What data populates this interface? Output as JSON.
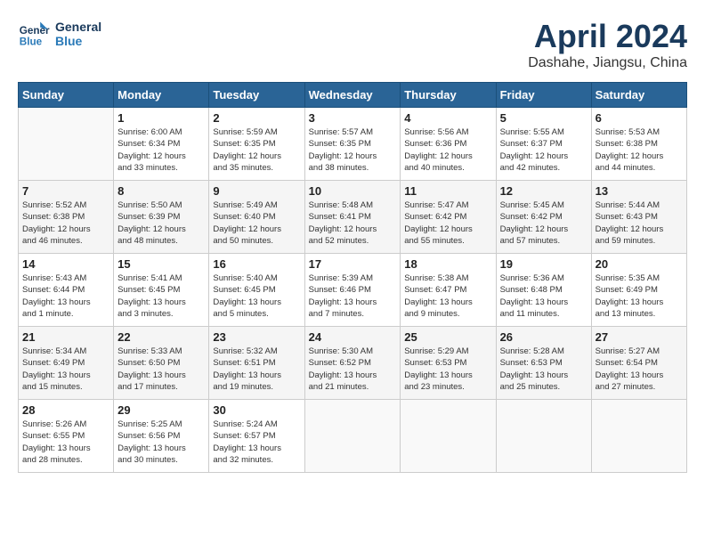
{
  "logo": {
    "line1": "General",
    "line2": "Blue"
  },
  "title": "April 2024",
  "location": "Dashahe, Jiangsu, China",
  "days_of_week": [
    "Sunday",
    "Monday",
    "Tuesday",
    "Wednesday",
    "Thursday",
    "Friday",
    "Saturday"
  ],
  "weeks": [
    [
      {
        "day": "",
        "info": ""
      },
      {
        "day": "1",
        "info": "Sunrise: 6:00 AM\nSunset: 6:34 PM\nDaylight: 12 hours\nand 33 minutes."
      },
      {
        "day": "2",
        "info": "Sunrise: 5:59 AM\nSunset: 6:35 PM\nDaylight: 12 hours\nand 35 minutes."
      },
      {
        "day": "3",
        "info": "Sunrise: 5:57 AM\nSunset: 6:35 PM\nDaylight: 12 hours\nand 38 minutes."
      },
      {
        "day": "4",
        "info": "Sunrise: 5:56 AM\nSunset: 6:36 PM\nDaylight: 12 hours\nand 40 minutes."
      },
      {
        "day": "5",
        "info": "Sunrise: 5:55 AM\nSunset: 6:37 PM\nDaylight: 12 hours\nand 42 minutes."
      },
      {
        "day": "6",
        "info": "Sunrise: 5:53 AM\nSunset: 6:38 PM\nDaylight: 12 hours\nand 44 minutes."
      }
    ],
    [
      {
        "day": "7",
        "info": "Sunrise: 5:52 AM\nSunset: 6:38 PM\nDaylight: 12 hours\nand 46 minutes."
      },
      {
        "day": "8",
        "info": "Sunrise: 5:50 AM\nSunset: 6:39 PM\nDaylight: 12 hours\nand 48 minutes."
      },
      {
        "day": "9",
        "info": "Sunrise: 5:49 AM\nSunset: 6:40 PM\nDaylight: 12 hours\nand 50 minutes."
      },
      {
        "day": "10",
        "info": "Sunrise: 5:48 AM\nSunset: 6:41 PM\nDaylight: 12 hours\nand 52 minutes."
      },
      {
        "day": "11",
        "info": "Sunrise: 5:47 AM\nSunset: 6:42 PM\nDaylight: 12 hours\nand 55 minutes."
      },
      {
        "day": "12",
        "info": "Sunrise: 5:45 AM\nSunset: 6:42 PM\nDaylight: 12 hours\nand 57 minutes."
      },
      {
        "day": "13",
        "info": "Sunrise: 5:44 AM\nSunset: 6:43 PM\nDaylight: 12 hours\nand 59 minutes."
      }
    ],
    [
      {
        "day": "14",
        "info": "Sunrise: 5:43 AM\nSunset: 6:44 PM\nDaylight: 13 hours\nand 1 minute."
      },
      {
        "day": "15",
        "info": "Sunrise: 5:41 AM\nSunset: 6:45 PM\nDaylight: 13 hours\nand 3 minutes."
      },
      {
        "day": "16",
        "info": "Sunrise: 5:40 AM\nSunset: 6:45 PM\nDaylight: 13 hours\nand 5 minutes."
      },
      {
        "day": "17",
        "info": "Sunrise: 5:39 AM\nSunset: 6:46 PM\nDaylight: 13 hours\nand 7 minutes."
      },
      {
        "day": "18",
        "info": "Sunrise: 5:38 AM\nSunset: 6:47 PM\nDaylight: 13 hours\nand 9 minutes."
      },
      {
        "day": "19",
        "info": "Sunrise: 5:36 AM\nSunset: 6:48 PM\nDaylight: 13 hours\nand 11 minutes."
      },
      {
        "day": "20",
        "info": "Sunrise: 5:35 AM\nSunset: 6:49 PM\nDaylight: 13 hours\nand 13 minutes."
      }
    ],
    [
      {
        "day": "21",
        "info": "Sunrise: 5:34 AM\nSunset: 6:49 PM\nDaylight: 13 hours\nand 15 minutes."
      },
      {
        "day": "22",
        "info": "Sunrise: 5:33 AM\nSunset: 6:50 PM\nDaylight: 13 hours\nand 17 minutes."
      },
      {
        "day": "23",
        "info": "Sunrise: 5:32 AM\nSunset: 6:51 PM\nDaylight: 13 hours\nand 19 minutes."
      },
      {
        "day": "24",
        "info": "Sunrise: 5:30 AM\nSunset: 6:52 PM\nDaylight: 13 hours\nand 21 minutes."
      },
      {
        "day": "25",
        "info": "Sunrise: 5:29 AM\nSunset: 6:53 PM\nDaylight: 13 hours\nand 23 minutes."
      },
      {
        "day": "26",
        "info": "Sunrise: 5:28 AM\nSunset: 6:53 PM\nDaylight: 13 hours\nand 25 minutes."
      },
      {
        "day": "27",
        "info": "Sunrise: 5:27 AM\nSunset: 6:54 PM\nDaylight: 13 hours\nand 27 minutes."
      }
    ],
    [
      {
        "day": "28",
        "info": "Sunrise: 5:26 AM\nSunset: 6:55 PM\nDaylight: 13 hours\nand 28 minutes."
      },
      {
        "day": "29",
        "info": "Sunrise: 5:25 AM\nSunset: 6:56 PM\nDaylight: 13 hours\nand 30 minutes."
      },
      {
        "day": "30",
        "info": "Sunrise: 5:24 AM\nSunset: 6:57 PM\nDaylight: 13 hours\nand 32 minutes."
      },
      {
        "day": "",
        "info": ""
      },
      {
        "day": "",
        "info": ""
      },
      {
        "day": "",
        "info": ""
      },
      {
        "day": "",
        "info": ""
      }
    ]
  ]
}
